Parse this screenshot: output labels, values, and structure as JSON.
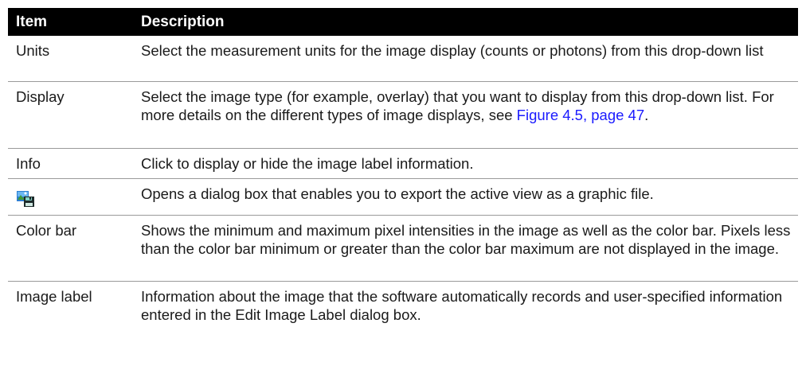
{
  "header": {
    "item": "Item",
    "description": "Description"
  },
  "rows": [
    {
      "item": "Units",
      "description": "Select the measurement units for the image display (counts or photons) from this drop-down list"
    },
    {
      "item": "Display",
      "description_before": "Select the image type (for example, overlay) that you want to display from this drop-down list. For more details on the different types of image displays, see ",
      "link": "Figure 4.5, page 47",
      "description_after": "."
    },
    {
      "item": "Info",
      "description": "Click to display or hide the image label information."
    },
    {
      "item_icon": "export-image-icon",
      "description": "Opens a dialog box that enables you to export the active view as a graphic file."
    },
    {
      "item": "Color bar",
      "description": "Shows the minimum and maximum pixel intensities in the image as well as the color bar. Pixels less than the color bar minimum or greater than the color bar maximum are not displayed in the image."
    },
    {
      "item": "Image label",
      "description": "Information about the image that the software automatically records and user-specified information entered in the Edit Image Label dialog box."
    }
  ],
  "colors": {
    "header_bg": "#000000",
    "header_text": "#ffffff",
    "link": "#1a1aff",
    "row_divider": "#9a9a9a"
  }
}
